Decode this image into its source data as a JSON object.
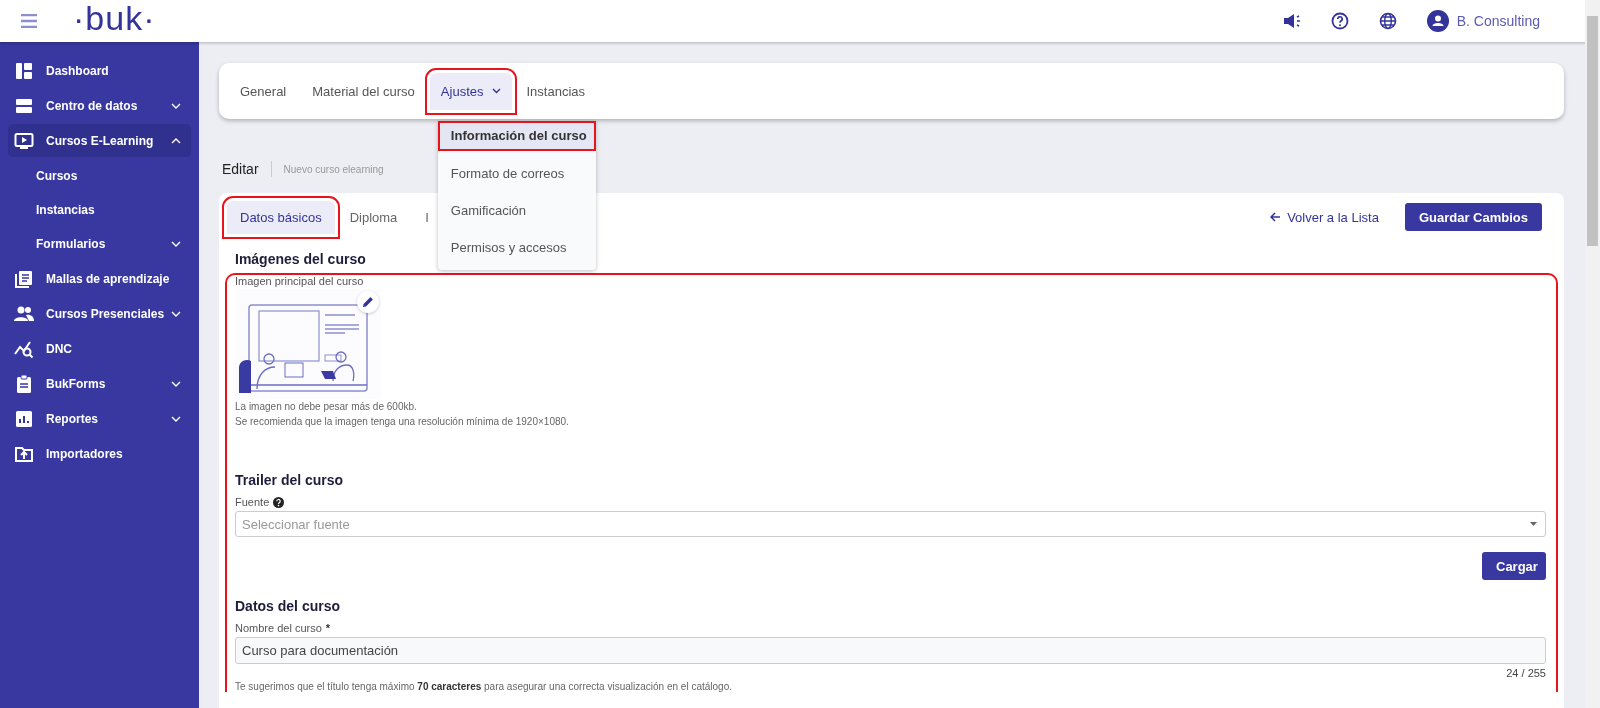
{
  "header": {
    "logo": "·buk·",
    "user": "B. Consulting"
  },
  "sidebar": {
    "items": [
      {
        "label": "Dashboard",
        "expandable": false,
        "selected": false
      },
      {
        "label": "Centro de datos",
        "expandable": true,
        "expanded": false,
        "selected": false
      },
      {
        "label": "Cursos E-Learning",
        "expandable": true,
        "expanded": true,
        "selected": true,
        "children": [
          {
            "label": "Cursos",
            "expandable": false
          },
          {
            "label": "Instancias",
            "expandable": false
          },
          {
            "label": "Formularios",
            "expandable": true,
            "expanded": false
          }
        ]
      },
      {
        "label": "Mallas de aprendizaje",
        "expandable": false,
        "selected": false
      },
      {
        "label": "Cursos Presenciales",
        "expandable": true,
        "expanded": false,
        "selected": false
      },
      {
        "label": "DNC",
        "expandable": false,
        "selected": false
      },
      {
        "label": "BukForms",
        "expandable": true,
        "expanded": false,
        "selected": false
      },
      {
        "label": "Reportes",
        "expandable": true,
        "expanded": false,
        "selected": false
      },
      {
        "label": "Importadores",
        "expandable": false,
        "selected": false
      }
    ]
  },
  "top_tabs": [
    {
      "label": "General",
      "selected": false,
      "highlighted": false,
      "dropdown": false
    },
    {
      "label": "Material del curso",
      "selected": false,
      "highlighted": false,
      "dropdown": false
    },
    {
      "label": "Ajustes",
      "selected": true,
      "highlighted": true,
      "dropdown": true
    },
    {
      "label": "Instancias",
      "selected": false,
      "highlighted": false,
      "dropdown": false
    }
  ],
  "settings_menu": [
    {
      "label": "Información del curso",
      "selected": true,
      "highlighted": true
    },
    {
      "label": "Formato de correos",
      "selected": false,
      "highlighted": false
    },
    {
      "label": "Gamificación",
      "selected": false,
      "highlighted": false
    },
    {
      "label": "Permisos y accesos",
      "selected": false,
      "highlighted": false
    }
  ],
  "page_header": {
    "title": "Editar",
    "subtitle": "Nuevo curso elearning"
  },
  "form_tabs": [
    {
      "label": "Datos básicos",
      "selected": true,
      "highlighted": true
    },
    {
      "label": "Diploma",
      "selected": false,
      "highlighted": false
    },
    {
      "label": "I",
      "selected": false,
      "highlighted": false
    }
  ],
  "back_link": "Volver a la Lista",
  "save_button": "Guardar Cambios",
  "images_section": {
    "title": "Imágenes del curso",
    "image_label": "Imagen principal del curso",
    "notes": [
      "La imagen no debe pesar más de 600kb.",
      "Se recomienda que la imagen tenga una resolución mínima de 1920×1080."
    ]
  },
  "form_body": {
    "highlighted": true
  },
  "trailer_section": {
    "title": "Trailer del curso",
    "field_label": "Fuente",
    "placeholder": "Seleccionar fuente",
    "button": "Cargar"
  },
  "course_section": {
    "title": "Datos del curso",
    "field_label": "Nombre del curso",
    "required_mark": "*",
    "value": "Curso para documentación",
    "counter": "24 / 255",
    "hint": "Te sugerimos que el título tenga máximo **70 caracteres** para asegurar una correcta visualización en el catálogo."
  }
}
